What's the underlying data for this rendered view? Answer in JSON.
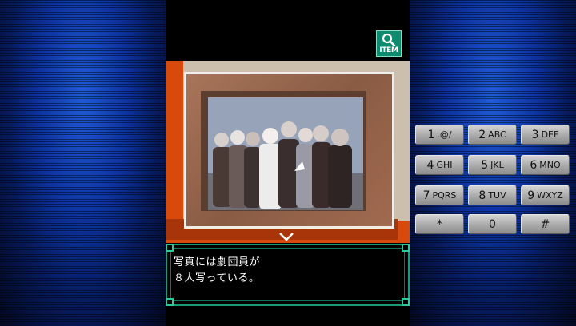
{
  "item_button": {
    "label": "ITEM",
    "icon": "magnifier-icon"
  },
  "message": {
    "text": "写真には劇団員が\n８人写っている。"
  },
  "keypad": {
    "keys": [
      {
        "num": "1",
        "sub": ".@/"
      },
      {
        "num": "2",
        "sub": "ABC"
      },
      {
        "num": "3",
        "sub": "DEF"
      },
      {
        "num": "4",
        "sub": "GHI"
      },
      {
        "num": "5",
        "sub": "JKL"
      },
      {
        "num": "6",
        "sub": "MNO"
      },
      {
        "num": "7",
        "sub": "PQRS"
      },
      {
        "num": "8",
        "sub": "TUV"
      },
      {
        "num": "9",
        "sub": "WXYZ"
      },
      {
        "num": "*",
        "sub": ""
      },
      {
        "num": "0",
        "sub": ""
      },
      {
        "num": "#",
        "sub": ""
      }
    ]
  },
  "colors": {
    "background_blue": "#0d35a6",
    "wall_orange": "#d84a0c",
    "wall_beige": "#cdbfae",
    "frame_brown": "#9a6a4e",
    "message_border": "#1b9a78",
    "item_button": "#0e8a6e"
  }
}
